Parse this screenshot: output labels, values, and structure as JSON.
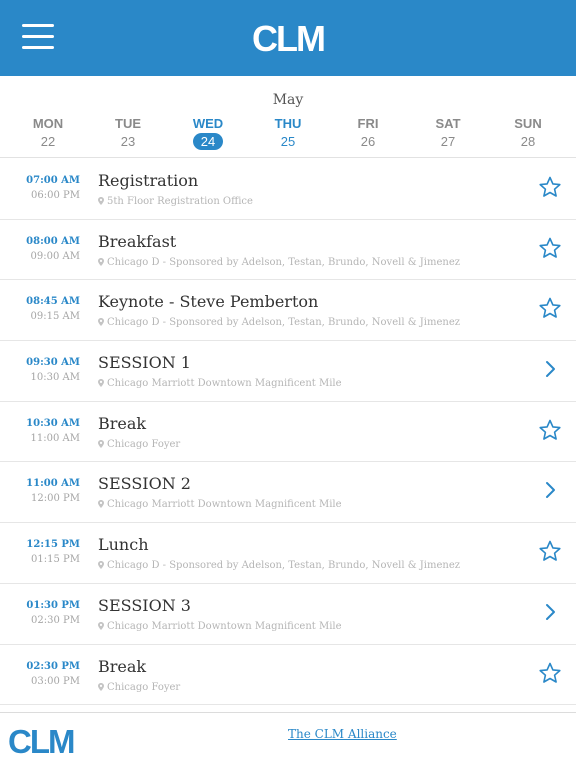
{
  "header": {
    "brand": "CLM",
    "menu_icon": "hamburger-menu-icon"
  },
  "calendar": {
    "month": "May",
    "days": [
      {
        "dow": "MON",
        "num": "22",
        "state": "normal"
      },
      {
        "dow": "TUE",
        "num": "23",
        "state": "normal"
      },
      {
        "dow": "WED",
        "num": "24",
        "state": "selected"
      },
      {
        "dow": "THU",
        "num": "25",
        "state": "next"
      },
      {
        "dow": "FRI",
        "num": "26",
        "state": "normal"
      },
      {
        "dow": "SAT",
        "num": "27",
        "state": "normal"
      },
      {
        "dow": "SUN",
        "num": "28",
        "state": "normal"
      }
    ]
  },
  "sessions": [
    {
      "start": "07:00 AM",
      "end": "06:00 PM",
      "title": "Registration",
      "location": "5th Floor Registration Office",
      "action": "star"
    },
    {
      "start": "08:00 AM",
      "end": "09:00 AM",
      "title": "Breakfast",
      "location": "Chicago D - Sponsored by Adelson, Testan, Brundo, Novell & Jimenez",
      "action": "star"
    },
    {
      "start": "08:45 AM",
      "end": "09:15 AM",
      "title": "Keynote - Steve Pemberton",
      "location": "Chicago D - Sponsored by Adelson, Testan, Brundo, Novell & Jimenez",
      "action": "star"
    },
    {
      "start": "09:30 AM",
      "end": "10:30 AM",
      "title": "SESSION 1",
      "location": "Chicago Marriott Downtown Magnificent Mile",
      "action": "chevron"
    },
    {
      "start": "10:30 AM",
      "end": "11:00 AM",
      "title": "Break",
      "location": "Chicago Foyer",
      "action": "star"
    },
    {
      "start": "11:00 AM",
      "end": "12:00 PM",
      "title": "SESSION 2",
      "location": "Chicago Marriott Downtown Magnificent Mile",
      "action": "chevron"
    },
    {
      "start": "12:15 PM",
      "end": "01:15 PM",
      "title": "Lunch",
      "location": "Chicago D - Sponsored by Adelson, Testan, Brundo, Novell & Jimenez",
      "action": "star"
    },
    {
      "start": "01:30 PM",
      "end": "02:30 PM",
      "title": "SESSION 3",
      "location": "Chicago Marriott Downtown Magnificent Mile",
      "action": "chevron"
    },
    {
      "start": "02:30 PM",
      "end": "03:00 PM",
      "title": "Break",
      "location": "Chicago Foyer",
      "action": "star"
    }
  ],
  "footer": {
    "logo": "CLM",
    "link": "The CLM Alliance"
  },
  "colors": {
    "accent": "#2a88c8",
    "muted": "#a5a5a5"
  }
}
